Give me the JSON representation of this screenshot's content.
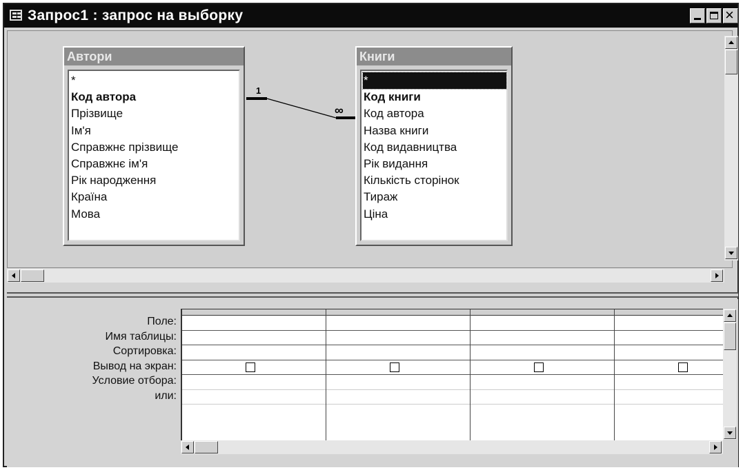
{
  "window": {
    "title": "Запрос1 : запрос на выборку"
  },
  "relationship": {
    "one_label": "1",
    "many_label": "∞"
  },
  "tables": [
    {
      "name": "Автори",
      "fields": [
        "*",
        "Код автора",
        "Прізвище",
        "Ім'я",
        "Справжнє прізвище",
        "Справжнє ім'я",
        "Рік народження",
        "Країна",
        "Мова"
      ],
      "key_field_index": 1
    },
    {
      "name": "Книги",
      "fields": [
        "*",
        "Код книги",
        "Код автора",
        "Назва книги",
        "Код видавництва",
        "Рік видання",
        "Кількість сторінок",
        "Тираж",
        "Ціна"
      ],
      "key_field_index": 1,
      "selected_field_index": 0
    }
  ],
  "design_grid": {
    "row_labels": [
      "Поле:",
      "Имя таблицы:",
      "Сортировка:",
      "Вывод на экран:",
      "Условие отбора:",
      "или:"
    ],
    "columns": 4,
    "show_checked": [
      false,
      false,
      false,
      false
    ]
  },
  "icons": [
    "query-icon",
    "minimize-icon",
    "maximize-icon",
    "close-icon",
    "scroll-up-icon",
    "scroll-down-icon",
    "scroll-left-icon",
    "scroll-right-icon"
  ]
}
